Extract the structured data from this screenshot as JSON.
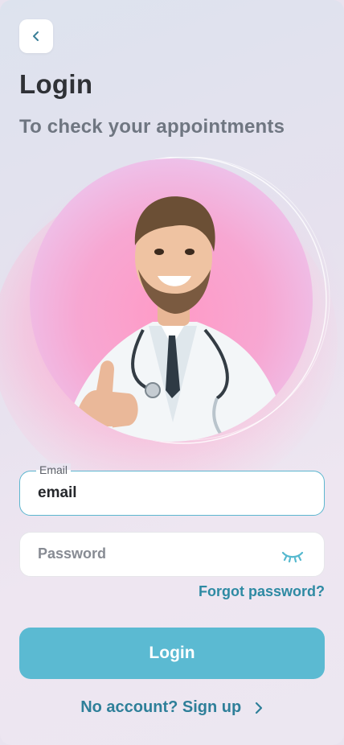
{
  "header": {
    "back_icon": "chevron-left-icon",
    "title": "Login",
    "subtitle": "To check your appointments"
  },
  "hero": {
    "subject": "smiling doctor giving thumbs up"
  },
  "form": {
    "email": {
      "label": "Email",
      "value": "email"
    },
    "password": {
      "placeholder": "Password",
      "toggle_icon": "eye-closed-icon"
    },
    "forgot_label": "Forgot password?",
    "login_label": "Login"
  },
  "footer": {
    "signup_label": "No account? Sign up",
    "signup_icon": "chevron-right-icon"
  },
  "colors": {
    "accent": "#5bbad2",
    "link": "#2e8aa3",
    "title": "#2f3136",
    "subtitle": "#6f7681"
  }
}
